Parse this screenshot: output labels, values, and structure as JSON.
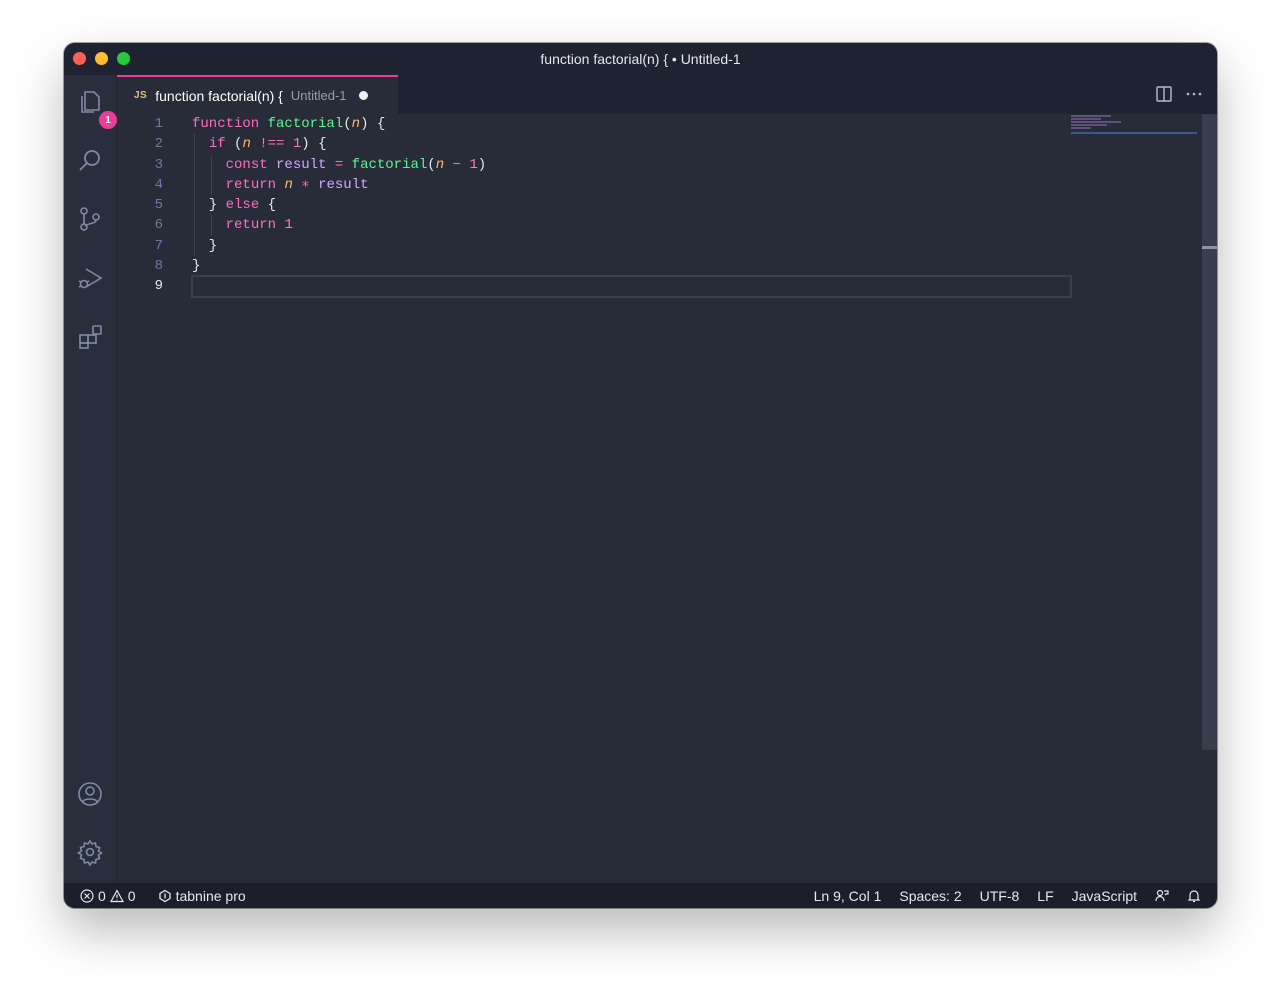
{
  "window": {
    "title": "function factorial(n) { • Untitled-1"
  },
  "activity": {
    "explorer_badge": "1"
  },
  "tab": {
    "lang_icon": "JS",
    "label": "function factorial(n) {",
    "description": "Untitled-1",
    "dirty": true
  },
  "editor": {
    "line_numbers": [
      "1",
      "2",
      "3",
      "4",
      "5",
      "6",
      "7",
      "8",
      "9"
    ],
    "current_line": 9,
    "lines": [
      [
        [
          "kw",
          "function"
        ],
        [
          "",
          "&nbsp;"
        ],
        [
          "fn",
          "factorial"
        ],
        [
          "",
          "("
        ],
        [
          "param",
          "n"
        ],
        [
          "",
          ") {"
        ]
      ],
      [
        [
          "",
          "  "
        ],
        [
          "kw",
          "if"
        ],
        [
          "",
          " ("
        ],
        [
          "param",
          "n"
        ],
        [
          "",
          " "
        ],
        [
          "op",
          "!=="
        ],
        [
          "",
          " "
        ],
        [
          "num",
          "1"
        ],
        [
          "",
          ") {"
        ]
      ],
      [
        [
          "",
          "    "
        ],
        [
          "kw",
          "const"
        ],
        [
          "",
          " "
        ],
        [
          "var",
          "result"
        ],
        [
          "",
          " "
        ],
        [
          "op",
          "="
        ],
        [
          "",
          " "
        ],
        [
          "fn",
          "factorial"
        ],
        [
          "",
          "("
        ],
        [
          "param",
          "n"
        ],
        [
          "",
          " "
        ],
        [
          "op",
          "−"
        ],
        [
          "",
          " "
        ],
        [
          "num",
          "1"
        ],
        [
          "",
          ")"
        ]
      ],
      [
        [
          "",
          "    "
        ],
        [
          "kw",
          "return"
        ],
        [
          "",
          " "
        ],
        [
          "param",
          "n"
        ],
        [
          "",
          " "
        ],
        [
          "op",
          "∗"
        ],
        [
          "",
          " "
        ],
        [
          "var",
          "result"
        ]
      ],
      [
        [
          "",
          "  } "
        ],
        [
          "kw",
          "else"
        ],
        [
          "",
          " {"
        ]
      ],
      [
        [
          "",
          "    "
        ],
        [
          "kw",
          "return"
        ],
        [
          "",
          " "
        ],
        [
          "num",
          "1"
        ]
      ],
      [
        [
          "",
          "  }"
        ]
      ],
      [
        [
          "",
          "}"
        ]
      ],
      [
        [
          "",
          ""
        ]
      ]
    ]
  },
  "statusbar": {
    "errors": "0",
    "warnings": "0",
    "tabnine": "tabnine pro",
    "position": "Ln 9, Col 1",
    "spaces": "Spaces: 2",
    "encoding": "UTF-8",
    "eol": "LF",
    "language": "JavaScript"
  }
}
